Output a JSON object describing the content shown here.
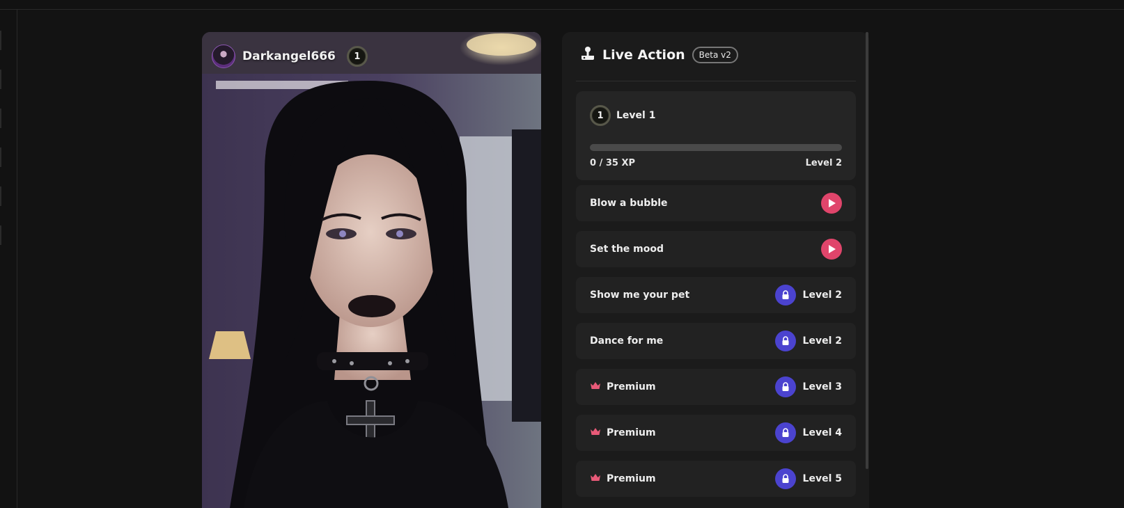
{
  "creator": {
    "name": "Darkangel666",
    "level": "1"
  },
  "panel": {
    "title": "Live Action",
    "badge": "Beta v2",
    "progress": {
      "current_level_number": "1",
      "current_level_label": "Level 1",
      "xp_text": "0 / 35 XP",
      "xp_fraction": 0,
      "next_level_label": "Level 2"
    },
    "actions": [
      {
        "label": "Blow a bubble",
        "state": "playable",
        "icon": "play-icon"
      },
      {
        "label": "Set the mood",
        "state": "playable",
        "icon": "play-icon"
      },
      {
        "label": "Show me your pet",
        "state": "locked",
        "icon": "lock-icon",
        "required_level": "Level 2"
      },
      {
        "label": "Dance for me",
        "state": "locked",
        "icon": "lock-icon",
        "required_level": "Level 2"
      },
      {
        "label": "Premium",
        "state": "locked",
        "premium": true,
        "icon": "crown-icon",
        "required_level": "Level 3"
      },
      {
        "label": "Premium",
        "state": "locked",
        "premium": true,
        "icon": "crown-icon",
        "required_level": "Level 4"
      },
      {
        "label": "Premium",
        "state": "locked",
        "premium": true,
        "icon": "crown-icon",
        "required_level": "Level 5"
      }
    ]
  },
  "colors": {
    "accent_play": "#e0456b",
    "accent_lock": "#4b43cf",
    "crown": "#e85a78"
  }
}
